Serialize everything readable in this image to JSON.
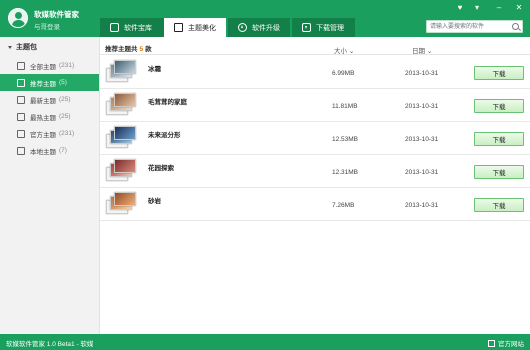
{
  "app": {
    "title": "软媒软件管家",
    "login_prompt": "与哥登录"
  },
  "tabs": [
    {
      "label": "软件宝库",
      "icon": "store-icon"
    },
    {
      "label": "主题美化",
      "icon": "tshirt-icon"
    },
    {
      "label": "软件升级",
      "icon": "upgrade-icon"
    },
    {
      "label": "下载管理",
      "icon": "download-manager-icon"
    }
  ],
  "search": {
    "placeholder": "请输入要搜索的软件"
  },
  "sidebar": {
    "group_title": "主题包",
    "items": [
      {
        "label": "全部主题",
        "count": "(231)",
        "icon": "all-themes-icon"
      },
      {
        "label": "推荐主题",
        "count": "(5)",
        "icon": "recommend-icon"
      },
      {
        "label": "最新主题",
        "count": "(25)",
        "icon": "new-icon"
      },
      {
        "label": "最热主题",
        "count": "(25)",
        "icon": "hot-icon"
      },
      {
        "label": "官方主题",
        "count": "(231)",
        "icon": "windows-icon"
      },
      {
        "label": "本地主题",
        "count": "(7)",
        "icon": "monitor-icon"
      }
    ]
  },
  "list": {
    "title_prefix": "推荐主题共",
    "count": "5",
    "title_suffix": "款",
    "col_size": "大小",
    "col_date": "日期",
    "rows": [
      {
        "name": "冰霜",
        "size": "6.99MB",
        "date": "2013-10-31",
        "button": "下载"
      },
      {
        "name": "毛茸茸的家庭",
        "size": "11.81MB",
        "date": "2013-10-31",
        "button": "下载"
      },
      {
        "name": "未来派分形",
        "size": "12.53MB",
        "date": "2013-10-31",
        "button": "下载"
      },
      {
        "name": "花园探索",
        "size": "12.31MB",
        "date": "2013-10-31",
        "button": "下载"
      },
      {
        "name": "砂岩",
        "size": "7.26MB",
        "date": "2013-10-31",
        "button": "下载"
      }
    ]
  },
  "footer": {
    "version": "软媒软件管家 1.0 Beta1 - 软媒",
    "official_site": "官方网站"
  },
  "colors": {
    "brand_green": "#1a9f5f",
    "active_item": "#23a866",
    "count_orange": "#e07000"
  }
}
